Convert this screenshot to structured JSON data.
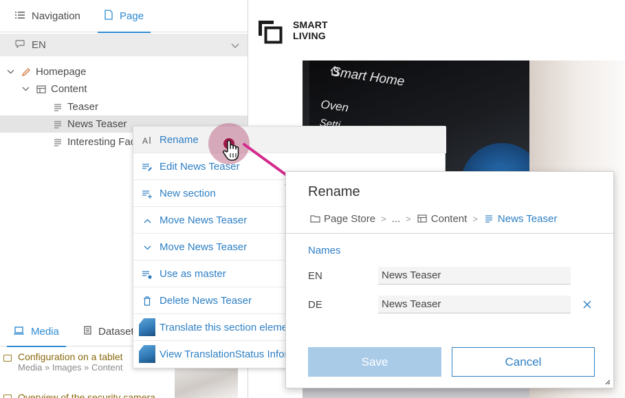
{
  "left_panel": {
    "tabs": [
      {
        "label": "Navigation",
        "icon": "list-icon"
      },
      {
        "label": "Page",
        "icon": "page-icon",
        "active": true
      }
    ],
    "language": {
      "label": "EN",
      "icon": "language-icon"
    },
    "tree": [
      {
        "label": "Homepage",
        "icon": "pencil-icon",
        "expanded": true
      },
      {
        "label": "Content",
        "icon": "section-icon",
        "expanded": true
      },
      {
        "label": "Teaser",
        "icon": "text-lines-icon"
      },
      {
        "label": "News Teaser",
        "icon": "text-lines-icon",
        "selected": true
      },
      {
        "label": "Interesting Facts",
        "icon": "text-lines-icon"
      }
    ],
    "bottom_tabs": [
      {
        "label": "Media",
        "icon": "laptop-icon",
        "active": true
      },
      {
        "label": "Datasets",
        "icon": "dataset-icon"
      }
    ],
    "media_items": [
      {
        "title": "Configuration on a tablet",
        "path": "Media » Images » Content"
      },
      {
        "title": "Overview of the security camera",
        "path": ""
      }
    ]
  },
  "preview": {
    "logo_text_line1": "SMART",
    "logo_text_line2": "LIVING",
    "hero_text_1": "Smart Home",
    "hero_text_2": "Oven",
    "hero_text_3": "Setti"
  },
  "context_menu": {
    "items": [
      {
        "label": "Rename",
        "icon": "rename-icon",
        "hover": true
      },
      {
        "label": "Edit News Teaser",
        "icon": "edit-lines-icon"
      },
      {
        "label": "New section",
        "icon": "add-lines-icon"
      },
      {
        "label": "Move News Teaser",
        "icon": "chevron-up-icon"
      },
      {
        "label": "Move News Teaser",
        "icon": "chevron-down-icon"
      },
      {
        "label": "Use as master",
        "icon": "master-lines-icon"
      },
      {
        "label": "Delete News Teaser",
        "icon": "trash-icon"
      },
      {
        "label": "Translate this section element",
        "icon": "translate-thumb-icon"
      },
      {
        "label": "View TranslationStatus Information",
        "icon": "translation-status-thumb-icon"
      }
    ]
  },
  "dialog": {
    "title": "Rename",
    "breadcrumb": [
      {
        "label": "Page Store",
        "icon": "folder-icon"
      },
      {
        "label": "...",
        "icon": ""
      },
      {
        "label": "Content",
        "icon": "section-icon"
      },
      {
        "label": "News Teaser",
        "icon": "text-lines-icon"
      }
    ],
    "names_label": "Names",
    "fields": [
      {
        "lang": "EN",
        "value": "News Teaser"
      },
      {
        "lang": "DE",
        "value": "News Teaser"
      }
    ],
    "save_label": "Save",
    "cancel_label": "Cancel"
  },
  "colors": {
    "accent": "#2d8ad2",
    "link": "#2d7fc4",
    "save_disabled": "#a9cbe8",
    "click_indicator": "#a0184a",
    "annotation_arrow": "#d42a8c",
    "media_title": "#8a6a10"
  }
}
